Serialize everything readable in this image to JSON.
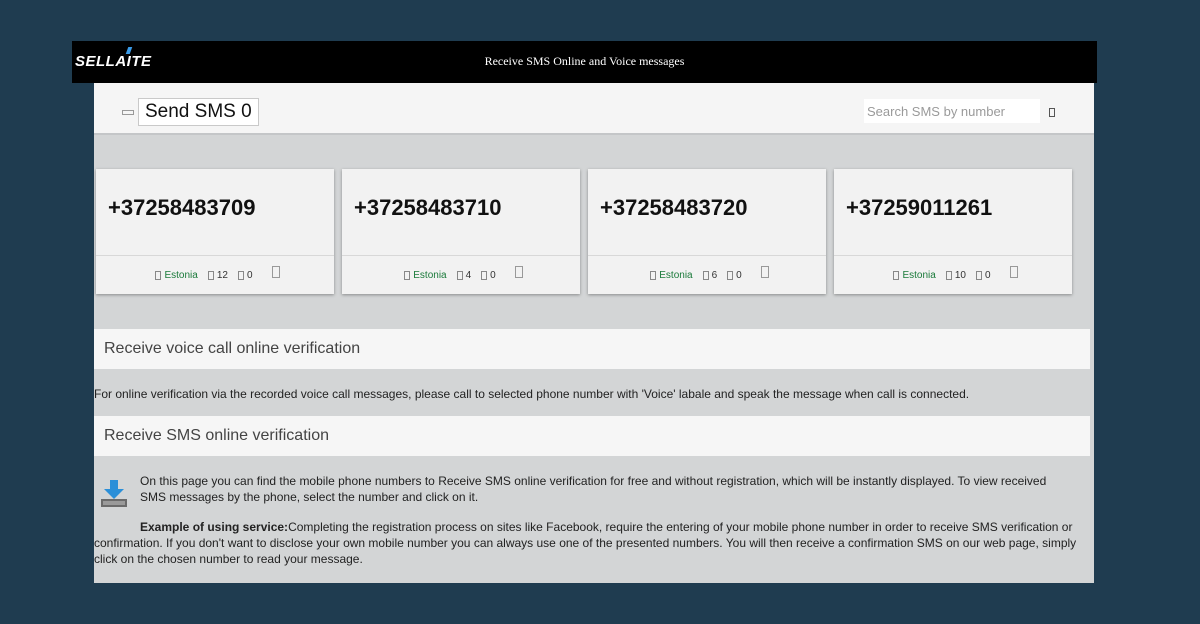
{
  "header": {
    "logo_text": "SELLAITE",
    "title": "Receive SMS Online and Voice messages"
  },
  "toolbar": {
    "send_sms_label": "Send SMS 0",
    "search_placeholder": "Search SMS by number"
  },
  "numbers": [
    {
      "phone": "+37258483709",
      "country": "Estonia",
      "messages": "12",
      "calls": "0"
    },
    {
      "phone": "+37258483710",
      "country": "Estonia",
      "messages": "4",
      "calls": "0"
    },
    {
      "phone": "+37258483720",
      "country": "Estonia",
      "messages": "6",
      "calls": "0"
    },
    {
      "phone": "+37259011261",
      "country": "Estonia",
      "messages": "10",
      "calls": "0"
    }
  ],
  "voice_section": {
    "heading": "Receive voice call online verification",
    "text": "For online verification via the recorded voice call messages, please call to selected phone number with 'Voice' labale and speak the message when call is connected."
  },
  "sms_section": {
    "heading": "Receive SMS online verification",
    "paragraph1": "On this page you can find the mobile phone numbers to Receive SMS online verification for free and without registration, which will be instantly displayed. To view received SMS messages by the phone, select the number and click on it.",
    "example_label": "Example of using service:",
    "paragraph2": "Completing the registration process on sites like Facebook, require the entering of your mobile phone number in order to receive SMS verification or confirmation. If you don't want to disclose your own mobile number you can always use one of the presented numbers. You will then receive a confirmation SMS on our web page, simply click on the chosen number to read your message."
  },
  "icons": {
    "menu": "menu-icon",
    "search": "search-icon",
    "country": "flag-icon",
    "messages": "message-icon",
    "calls": "phone-icon",
    "card_action": "copy-icon",
    "info": "download-icon"
  },
  "colors": {
    "background": "#1f3c50",
    "topbar": "#000000",
    "content": "#d3d5d6",
    "country_text": "#1a7a3a",
    "download_icon": "#2b8fd8"
  }
}
